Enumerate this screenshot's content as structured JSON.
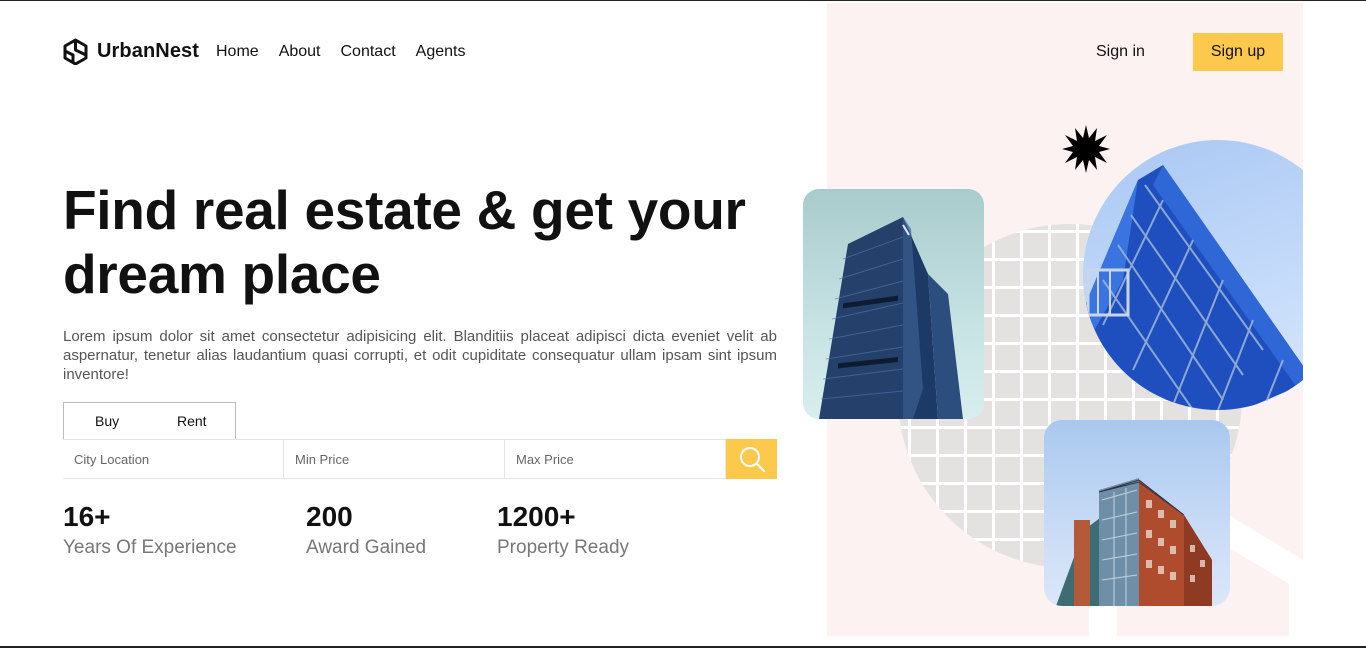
{
  "brand": {
    "name": "UrbanNest",
    "logo_icon": "house-logo-icon"
  },
  "nav": {
    "links": [
      "Home",
      "About",
      "Contact",
      "Agents"
    ],
    "signin_label": "Sign in",
    "signup_label": "Sign up"
  },
  "hero": {
    "headline": "Find real estate & get your dream place",
    "intro": "Lorem ipsum dolor sit amet consectetur adipisicing elit. Blanditiis placeat adipisci dicta eveniet velit ab aspernatur, tenetur alias laudantium quasi corrupti, et odit cupiditate consequatur ullam ipsam sint ipsum inventore!"
  },
  "search": {
    "tabs": [
      "Buy",
      "Rent"
    ],
    "city_placeholder": "City Location",
    "min_placeholder": "Min Price",
    "max_placeholder": "Max Price",
    "button_icon": "search-icon"
  },
  "stats": [
    {
      "value": "16+",
      "label": "Years Of Experience"
    },
    {
      "value": "200",
      "label": "Award Gained"
    },
    {
      "value": "1200+",
      "label": "Property Ready"
    }
  ],
  "colors": {
    "accent": "#fcc94c",
    "panel_bg": "#fbf2f1",
    "text": "#111111",
    "muted": "#777777"
  }
}
